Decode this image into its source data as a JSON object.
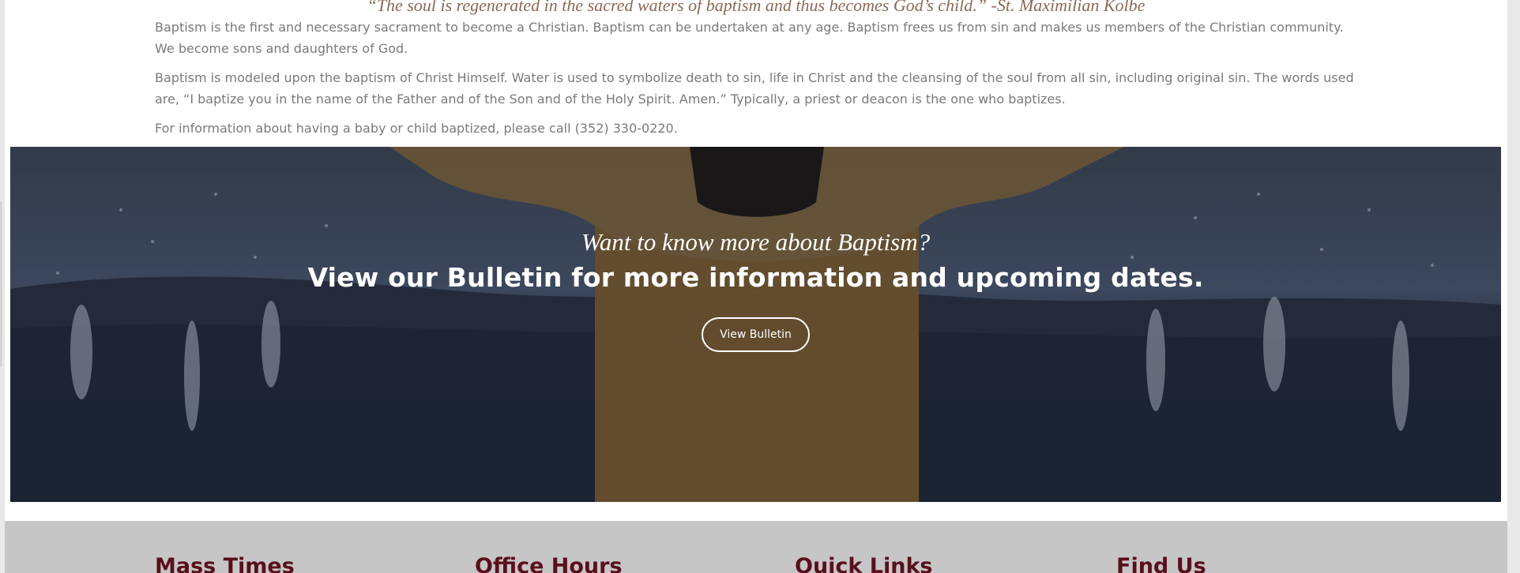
{
  "intro": {
    "quote": "“The soul is regenerated in the sacred waters of baptism and thus becomes God’s child.” -St. Maximilian Kolbe",
    "paragraphs": [
      "Baptism is the first and necessary sacrament to become a Christian. Baptism can be undertaken at any age. Baptism frees us from sin and makes us members of the Christian community. We become sons and daughters of God.",
      "Baptism is modeled upon the baptism of Christ Himself. Water is used to symbolize death to sin, life in Christ and the cleansing of the soul from all sin, including original sin. The words used are, “I baptize you in the name of the Father and of the Son and of the Holy Spirit. Amen.” Typically, a priest or deacon is the one who baptizes.",
      "For information about having a baby or child baptized, please call (352) 330-0220."
    ]
  },
  "hero": {
    "subtitle": "Want to know more about Baptism?",
    "title": "View our Bulletin for more information and upcoming dates.",
    "button_label": "View Bulletin"
  },
  "footer": {
    "headings": [
      "Mass Times",
      "Office Hours",
      "Quick Links",
      "Find Us"
    ]
  },
  "colors": {
    "quote": "#8a6a57",
    "body_text": "#7a7a7a",
    "footer_bg": "#c6c6c6",
    "footer_heading": "#5a0f1c"
  }
}
